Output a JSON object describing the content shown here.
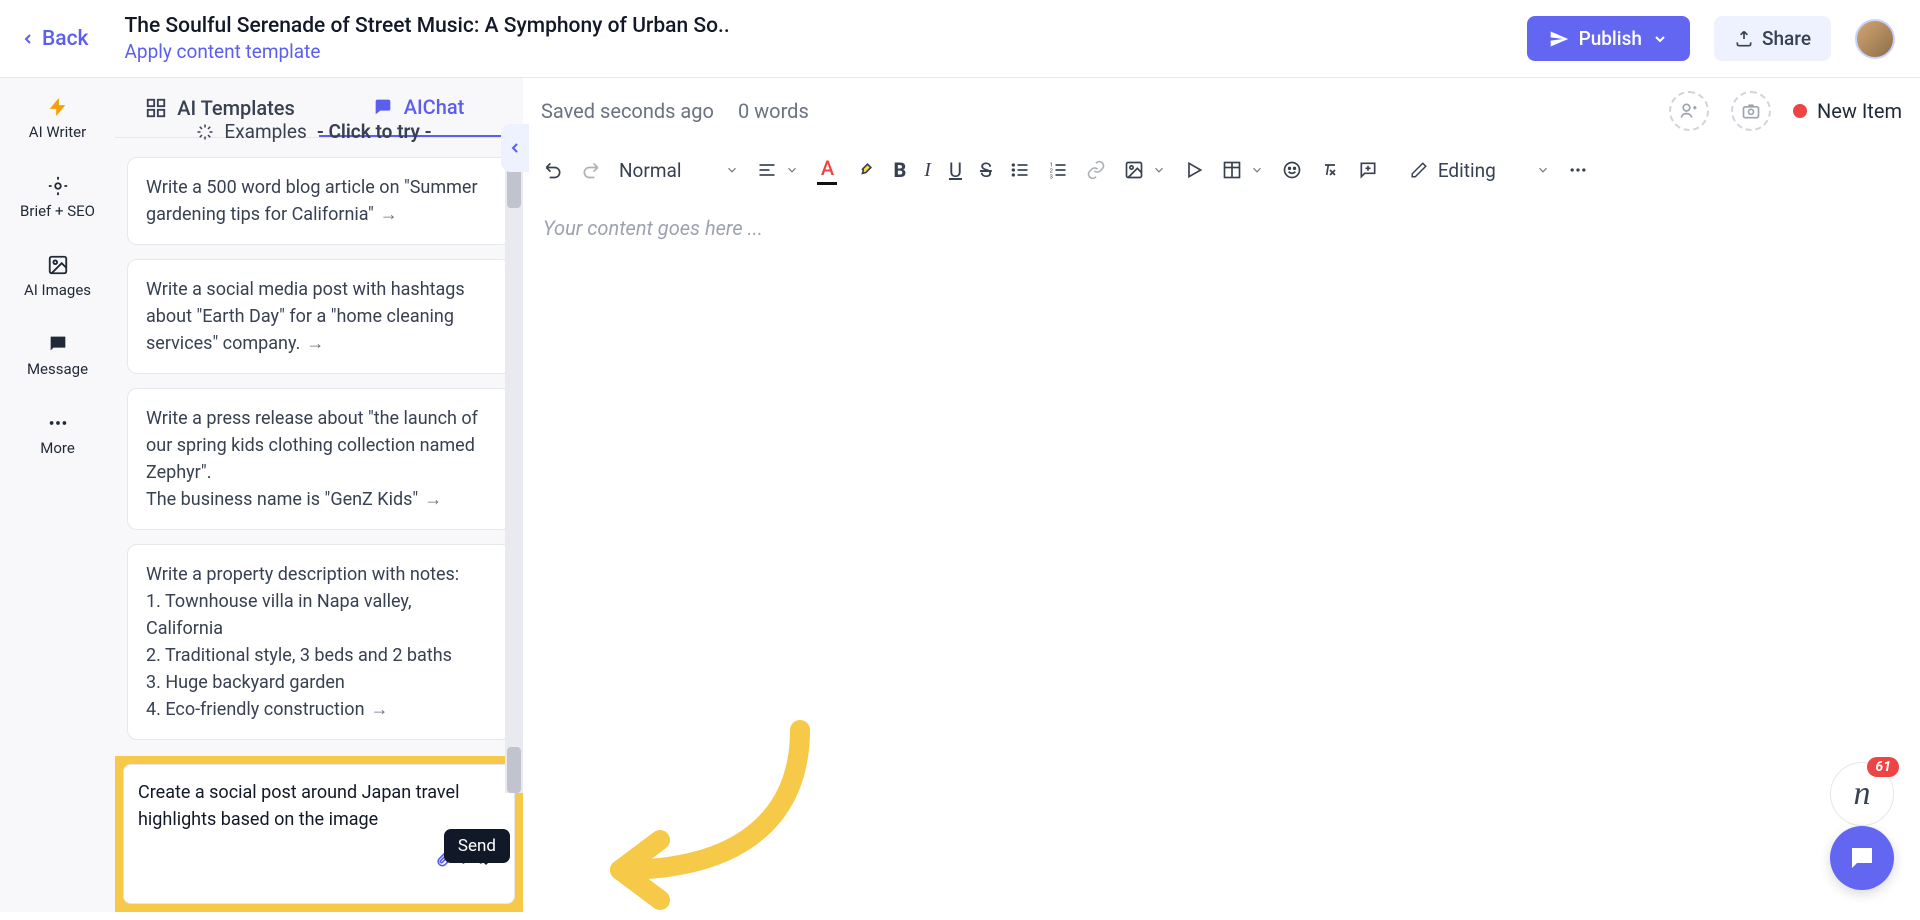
{
  "header": {
    "back": "Back",
    "title": "The Soulful Serenade of Street Music: A Symphony of Urban So..",
    "apply_template": "Apply content template",
    "publish": "Publish",
    "share": "Share"
  },
  "rail": {
    "items": [
      {
        "name": "ai-writer",
        "label": "AI Writer"
      },
      {
        "name": "brief-seo",
        "label": "Brief + SEO"
      },
      {
        "name": "ai-images",
        "label": "AI Images"
      },
      {
        "name": "message",
        "label": "Message"
      },
      {
        "name": "more",
        "label": "More"
      }
    ]
  },
  "panel": {
    "tabs": {
      "templates": "AI Templates",
      "chat": "AIChat"
    },
    "examples_title": "Examples",
    "examples_sub": "- Click to try -",
    "examples": [
      "Write a 500 word blog article on \"Summer gardening tips for California\"",
      "Write a social media post with hashtags about \"Earth Day\" for a \"home cleaning services\" company.",
      "Write a press release about \"the launch of our spring kids clothing collection named Zephyr\".\nThe business name is \"GenZ Kids\"",
      "Write a property description with notes:\n1. Townhouse villa in Napa valley, California\n2. Traditional style, 3 beds and 2 baths\n3. Huge backyard garden\n4. Eco-friendly construction"
    ],
    "input_value": "Create a social post around Japan travel highlights based on the image",
    "attachment_count": "1",
    "send_tooltip": "Send"
  },
  "editor": {
    "saved": "Saved seconds ago",
    "wordcount": "0 words",
    "new_item": "New Item",
    "style_select": "Normal",
    "mode": "Editing",
    "placeholder": "Your content goes here ..."
  },
  "bubbles": {
    "badge": "61"
  }
}
